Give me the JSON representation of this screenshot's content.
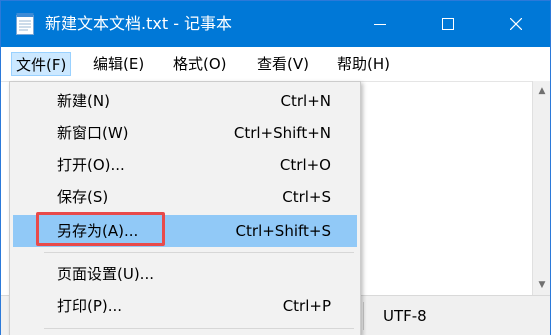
{
  "window": {
    "title": "新建文本文档.txt - 记事本"
  },
  "menubar": {
    "file": "文件(F)",
    "edit": "编辑(E)",
    "format": "格式(O)",
    "view": "查看(V)",
    "help": "帮助(H)"
  },
  "file_menu": {
    "items": [
      {
        "label": "新建(N)",
        "shortcut": "Ctrl+N"
      },
      {
        "label": "新窗口(W)",
        "shortcut": "Ctrl+Shift+N"
      },
      {
        "label": "打开(O)...",
        "shortcut": "Ctrl+O"
      },
      {
        "label": "保存(S)",
        "shortcut": "Ctrl+S"
      },
      {
        "label": "另存为(A)...",
        "shortcut": "Ctrl+Shift+S",
        "highlighted": true
      },
      {
        "label": "页面设置(U)...",
        "shortcut": ""
      },
      {
        "label": "打印(P)...",
        "shortcut": "Ctrl+P"
      }
    ]
  },
  "statusbar": {
    "encoding": "UTF-8"
  },
  "colors": {
    "titlebar": "#0078d7",
    "menu_highlight": "#91c9f7",
    "focus_box": "#e84a4a",
    "menubar_active": "#cce8ff"
  },
  "icons": {
    "app": "notepad-icon",
    "minimize": "minimize-icon",
    "maximize": "maximize-icon",
    "close": "close-icon"
  }
}
